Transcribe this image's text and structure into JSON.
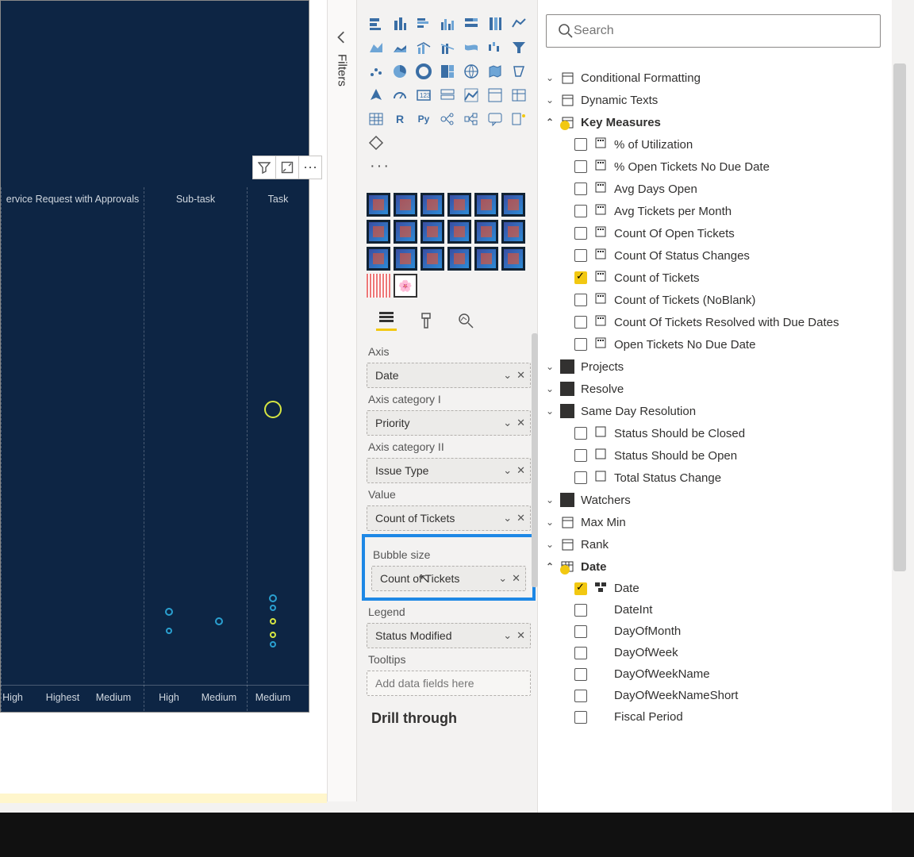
{
  "filters_label": "Filters",
  "canvas": {
    "toolbar": {
      "filter": "⚲",
      "focus": "⤢",
      "more": "⋯"
    },
    "columns_top": [
      "ervice Request with Approvals",
      "Sub-task",
      "Task"
    ],
    "columns_bottom": [
      "High",
      "Highest",
      "Medium",
      "High",
      "Medium",
      "Medium"
    ]
  },
  "chart_data": {
    "type": "scatter",
    "note": "partial view of bubble chart; values estimated from vertical position (0..1) — actual axis labels not visible",
    "axis_category_i": "Priority",
    "axis_category_ii": "Issue Type",
    "axis": "Date",
    "value_measure": "Count of Tickets",
    "size_measure": "Count of Tickets",
    "legend_field": "Status Modified",
    "bubbles": [
      {
        "col": 5,
        "y": 0.44,
        "r": 11,
        "color": "#d6e642"
      },
      {
        "col": 3,
        "y": 0.88,
        "r": 5,
        "color": "#2aa0d0"
      },
      {
        "col": 3,
        "y": 0.92,
        "r": 4,
        "color": "#2aa0d0"
      },
      {
        "col": 4,
        "y": 0.9,
        "r": 5,
        "color": "#2aa0d0"
      },
      {
        "col": 5,
        "y": 0.85,
        "r": 5,
        "color": "#2aa0d0"
      },
      {
        "col": 5,
        "y": 0.9,
        "r": 4,
        "color": "#d6e642"
      },
      {
        "col": 5,
        "y": 0.93,
        "r": 4,
        "color": "#d6e642"
      },
      {
        "col": 5,
        "y": 0.95,
        "r": 4,
        "color": "#2aa0d0"
      },
      {
        "col": 5,
        "y": 0.87,
        "r": 4,
        "color": "#2aa0d0"
      }
    ]
  },
  "viz": {
    "wells": {
      "axis_label": "Axis",
      "axis_value": "Date",
      "cat1_label": "Axis category I",
      "cat1_value": "Priority",
      "cat2_label": "Axis category II",
      "cat2_value": "Issue Type",
      "val_label": "Value",
      "val_value": "Count of Tickets",
      "bsize_label": "Bubble size",
      "bsize_value": "Count of Tickets",
      "legend_label": "Legend",
      "legend_value": "Status Modified",
      "tooltip_label": "Tooltips",
      "tooltip_placeholder": "Add data fields here"
    },
    "drill_label": "Drill through"
  },
  "fields": {
    "search_placeholder": "Search",
    "tables": {
      "cond_fmt": "Conditional Formatting",
      "dyn_texts": "Dynamic Texts",
      "key_measures": "Key Measures",
      "projects": "Projects",
      "resolve": "Resolve",
      "same_day": "Same Day Resolution",
      "watchers": "Watchers",
      "maxmin": "Max Min",
      "rank": "Rank",
      "date": "Date"
    },
    "key_measure_items": [
      "% of Utilization",
      "% Open Tickets No Due Date",
      "Avg Days Open",
      "Avg Tickets per Month",
      "Count Of Open Tickets",
      "Count Of Status Changes",
      "Count of Tickets",
      "Count of Tickets (NoBlank)",
      "Count Of Tickets Resolved with Due Dates",
      "Open Tickets No Due Date"
    ],
    "same_day_items": [
      "Status Should be Closed",
      "Status Should be Open",
      "Total Status Change"
    ],
    "date_items": [
      "Date",
      "DateInt",
      "DayOfMonth",
      "DayOfWeek",
      "DayOfWeekName",
      "DayOfWeekNameShort",
      "Fiscal Period"
    ]
  }
}
